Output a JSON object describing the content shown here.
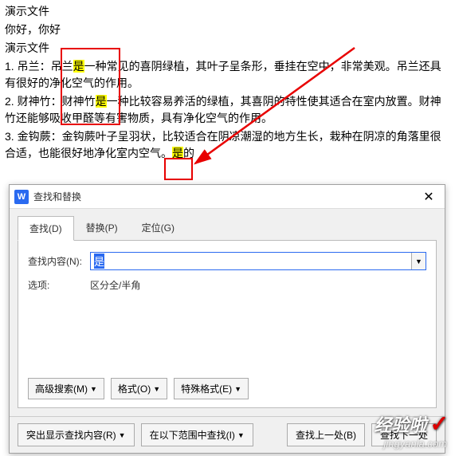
{
  "doc": {
    "line1": "演示文件",
    "line2": "你好，你好",
    "line3": "演示文件",
    "p1_a": "1. 吊兰：吊兰",
    "p1_b": "是",
    "p1_c": "一种常见的喜阴绿植，其叶子呈条形，垂挂在空中，非常美观。吊兰还具有很好的净化空气的作用。",
    "p2_a": "2. 财神竹：财神竹",
    "p2_b": "是",
    "p2_c": "一种比较容易养活的绿植，其喜阴的特性使其适合在室内放置。财神竹还能够吸收甲醛等有害物质，具有净化空气的作用。",
    "p3_a": "3. 金钩蕨：金钩蕨叶子呈羽状，比较适合在阴凉潮湿的地方生长，栽种在阴凉的角落里很合适，也能很好地净化室内空气。",
    "p3_b": "是",
    "p3_c": "的"
  },
  "dialog": {
    "title": "查找和替换",
    "icon_letter": "W",
    "tabs": {
      "find": "查找(D)",
      "replace": "替换(P)",
      "goto": "定位(G)"
    },
    "find_label": "查找内容(N):",
    "find_value": "是",
    "options_label": "选项:",
    "options_value": "区分全/半角",
    "adv_search": "高级搜索(M)",
    "format": "格式(O)",
    "special": "特殊格式(E)",
    "highlight": "突出显示查找内容(R)",
    "in_range": "在以下范围中查找(I)",
    "prev": "查找上一处(B)",
    "next": "查找下一处"
  },
  "watermark": {
    "text": "经验啦",
    "url": "jingyanla.com"
  }
}
